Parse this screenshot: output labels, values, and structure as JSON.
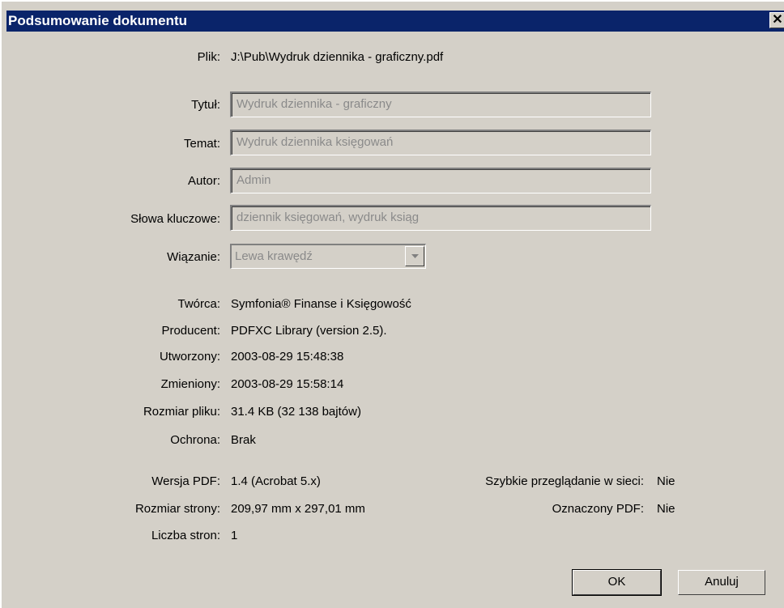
{
  "window": {
    "title": "Podsumowanie dokumentu",
    "close_glyph": "✕"
  },
  "file": {
    "label": "Plik:",
    "value": "J:\\Pub\\Wydruk dziennika - graficzny.pdf"
  },
  "fields": {
    "title": {
      "label": "Tytuł:",
      "value": "Wydruk dziennika - graficzny"
    },
    "subject": {
      "label": "Temat:",
      "value": "Wydruk dziennika księgowań"
    },
    "author": {
      "label": "Autor:",
      "value": "Admin"
    },
    "keywords": {
      "label": "Słowa kluczowe:",
      "value": "dziennik księgowań, wydruk ksiąg"
    }
  },
  "binding": {
    "label": "Wiązanie:",
    "value": "Lewa krawędź"
  },
  "info": {
    "creator": {
      "label": "Twórca:",
      "value": "Symfonia® Finanse i Księgowość"
    },
    "producer": {
      "label": "Producent:",
      "value": "PDFXC Library (version 2.5)."
    },
    "created": {
      "label": "Utworzony:",
      "value": "2003-08-29 15:48:38"
    },
    "modified": {
      "label": "Zmieniony:",
      "value": "2003-08-29 15:58:14"
    },
    "file_size": {
      "label": "Rozmiar pliku:",
      "value": "31.4 KB (32 138 bajtów)"
    },
    "security": {
      "label": "Ochrona:",
      "value": "Brak"
    }
  },
  "pdf": {
    "version": {
      "label": "Wersja PDF:",
      "value": "1.4 (Acrobat 5.x)"
    },
    "page_size": {
      "label": "Rozmiar strony:",
      "value": "209,97 mm x 297,01 mm"
    },
    "page_count": {
      "label": "Liczba stron:",
      "value": "1"
    },
    "fast_web_view": {
      "label": "Szybkie przeglądanie w sieci:",
      "value": "Nie"
    },
    "tagged": {
      "label": "Oznaczony PDF:",
      "value": "Nie"
    }
  },
  "buttons": {
    "ok": "OK",
    "cancel": "Anuluj"
  }
}
